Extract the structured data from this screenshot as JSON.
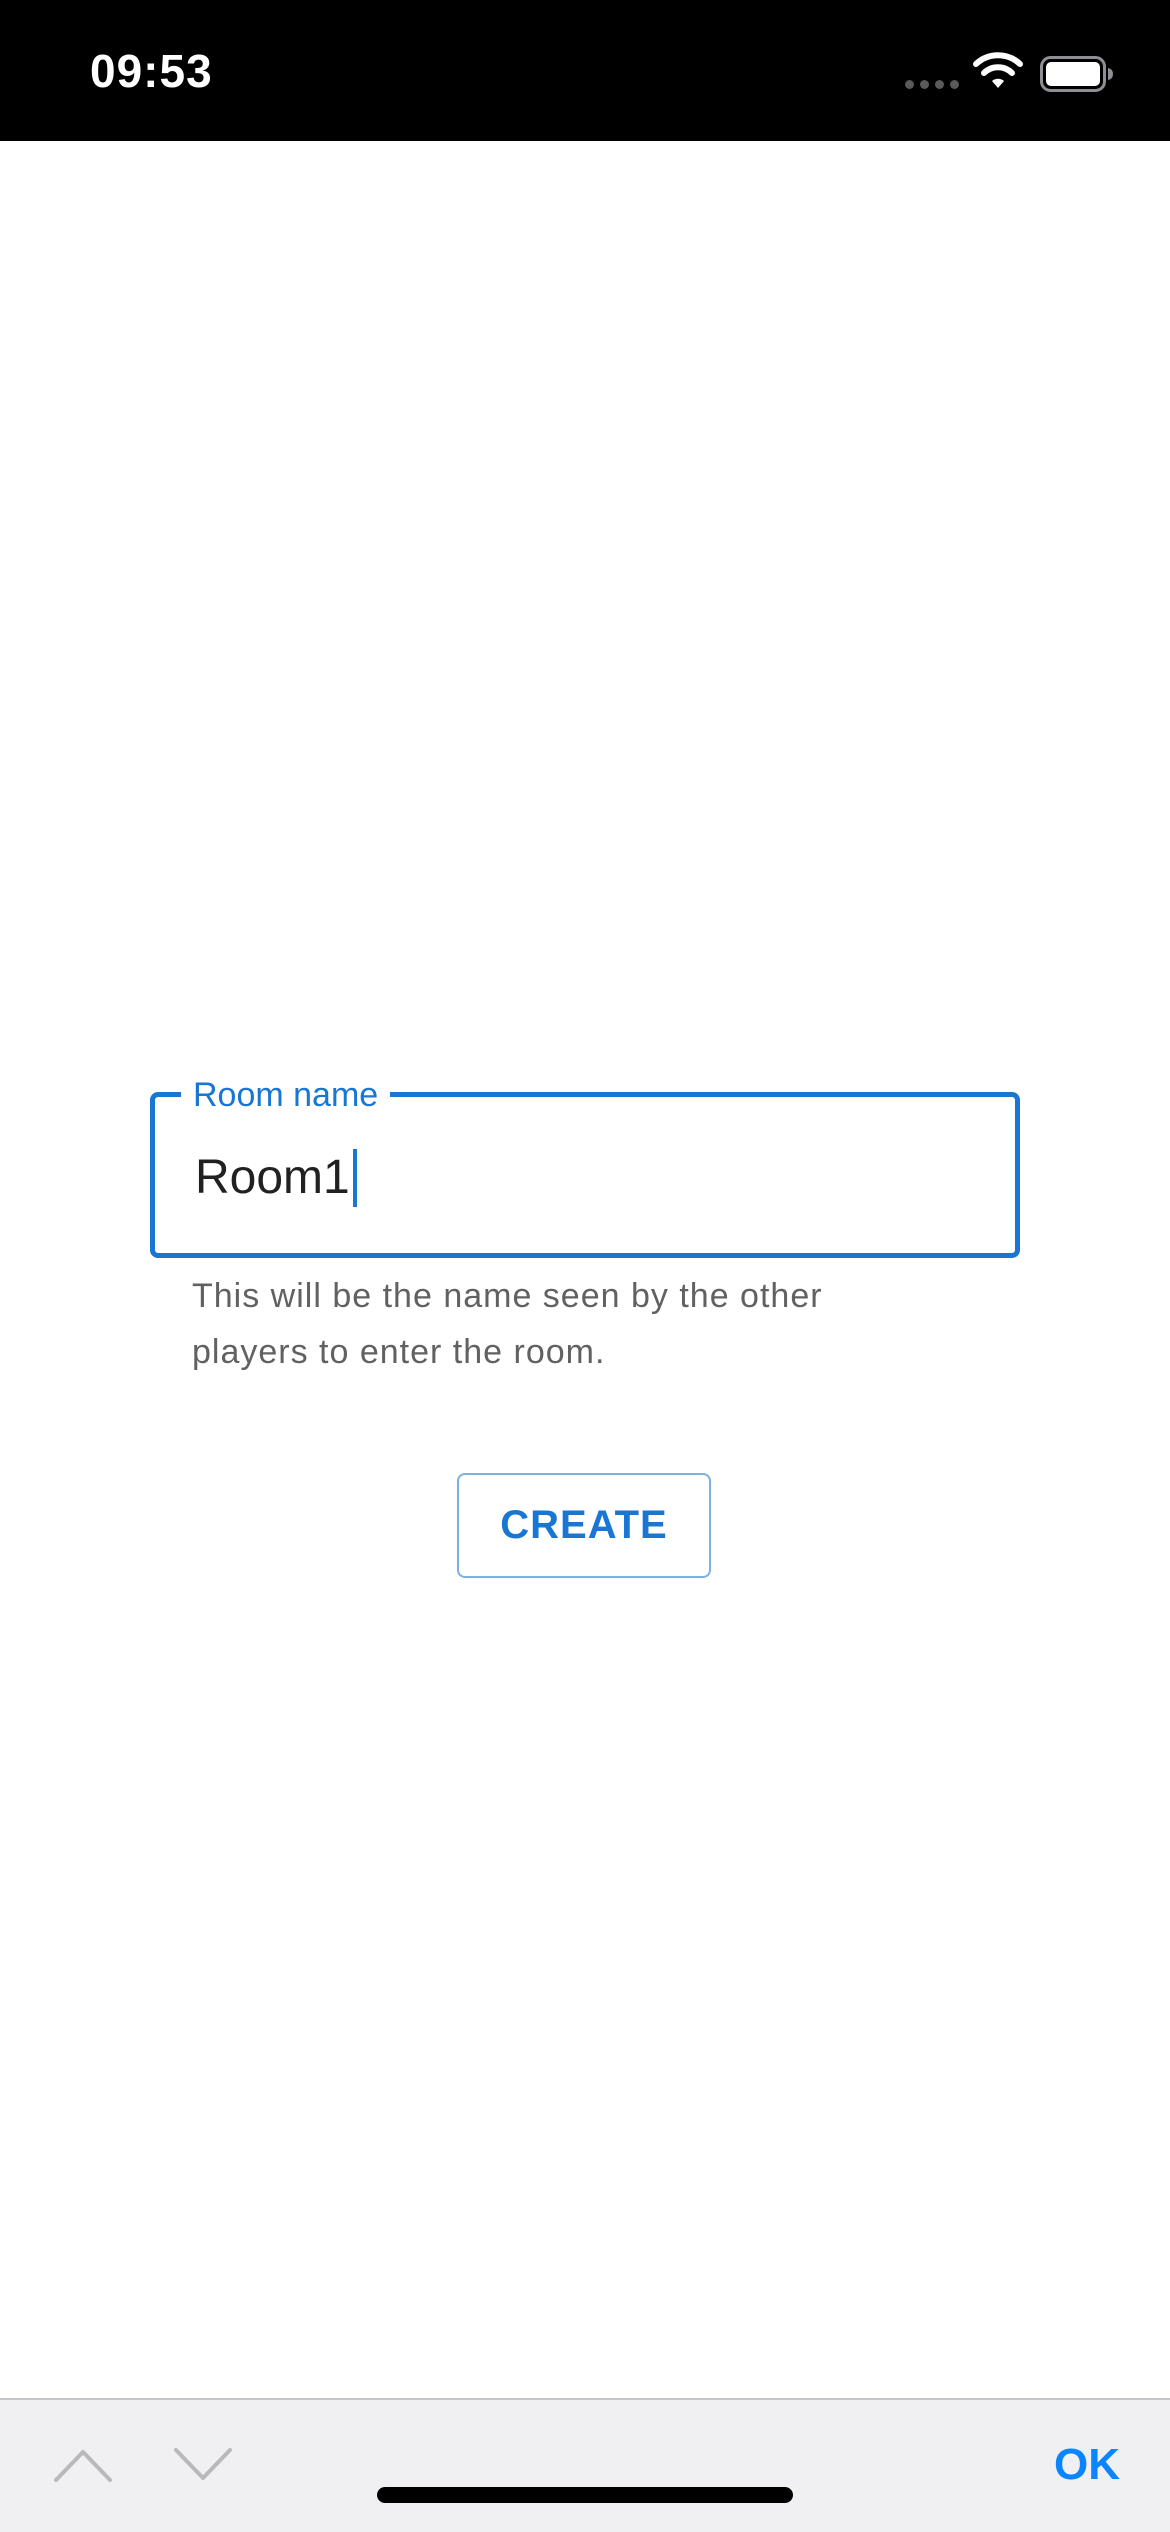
{
  "status_bar": {
    "time": "09:53",
    "icons": [
      "signal-dots-icon",
      "wifi-icon",
      "battery-icon"
    ]
  },
  "form": {
    "field_label": "Room name",
    "field_value": "Room1",
    "helper_line_1": "This will be the name seen by the other",
    "helper_line_2": "players to enter the room.",
    "create_label": "CREATE"
  },
  "keyboard_bar": {
    "previous_icon": "chevron-up-icon",
    "next_icon": "chevron-down-icon",
    "ok_label": "OK"
  },
  "colors": {
    "accent": "#1976d2",
    "ios_blue": "#0a84ff",
    "helper_text": "#616161",
    "status_bar_bg": "#000000",
    "accessory_bg": "#f0f0f3"
  }
}
